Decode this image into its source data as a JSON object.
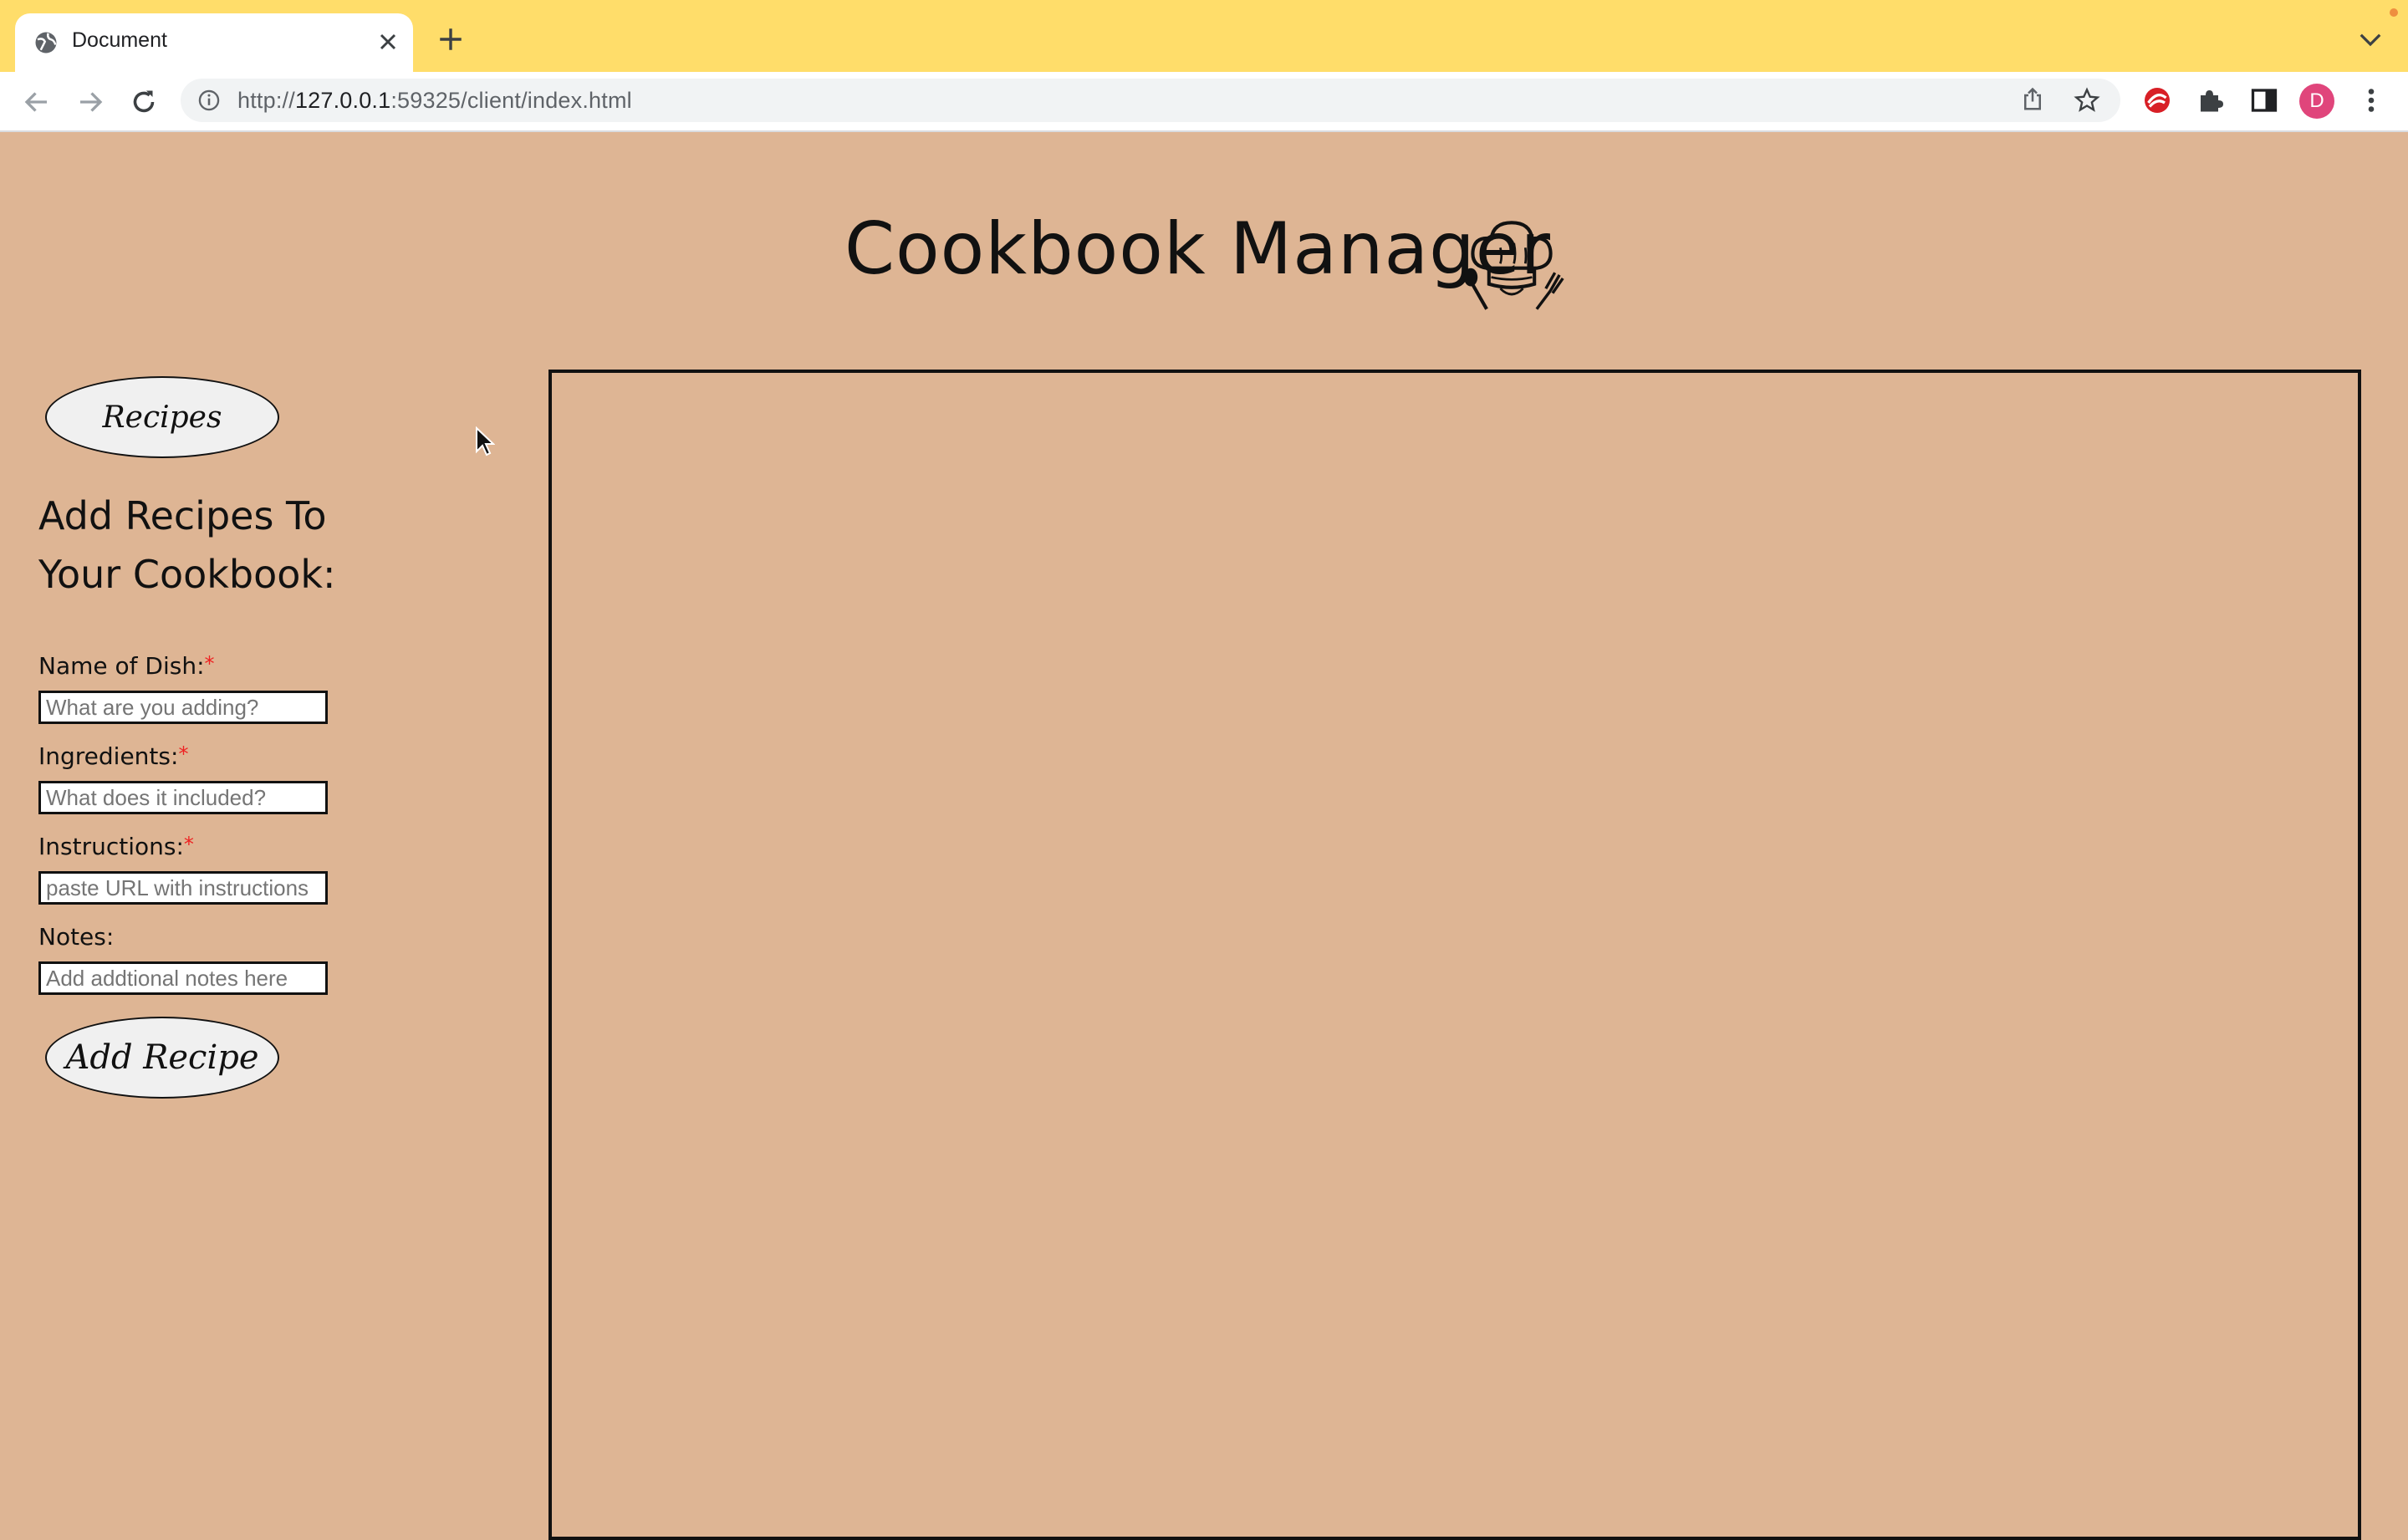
{
  "browser": {
    "tab_title": "Document",
    "url_prefix": "http://",
    "url_host": "127.0.0.1",
    "url_rest": ":59325/client/index.html",
    "profile_initial": "D"
  },
  "page": {
    "title": "Cookbook Manager",
    "recipes_button": "Recipes",
    "form_heading": "Add Recipes To Your Cookbook:",
    "fields": [
      {
        "label": "Name of Dish:",
        "placeholder": "What are you adding?",
        "required": "*"
      },
      {
        "label": "Ingredients:",
        "placeholder": "What does it included?",
        "required": "*"
      },
      {
        "label": "Instructions:",
        "placeholder": "paste URL with instructions",
        "required": "*"
      },
      {
        "label": "Notes:",
        "placeholder": "Add addtional notes here"
      }
    ],
    "add_button": "Add Recipe"
  },
  "colors": {
    "page_background": "#deb594",
    "tab_strip": "#ffdd6a",
    "required_marker": "#e22222"
  },
  "icons": [
    "globe-icon",
    "close-icon",
    "plus-icon",
    "chevron-down-icon",
    "back-arrow-icon",
    "forward-arrow-icon",
    "reload-icon",
    "info-icon",
    "share-icon",
    "star-icon",
    "extension-icon",
    "puzzle-icon",
    "sidebar-icon",
    "more-icon",
    "chef-hat-icon",
    "cursor-icon"
  ]
}
